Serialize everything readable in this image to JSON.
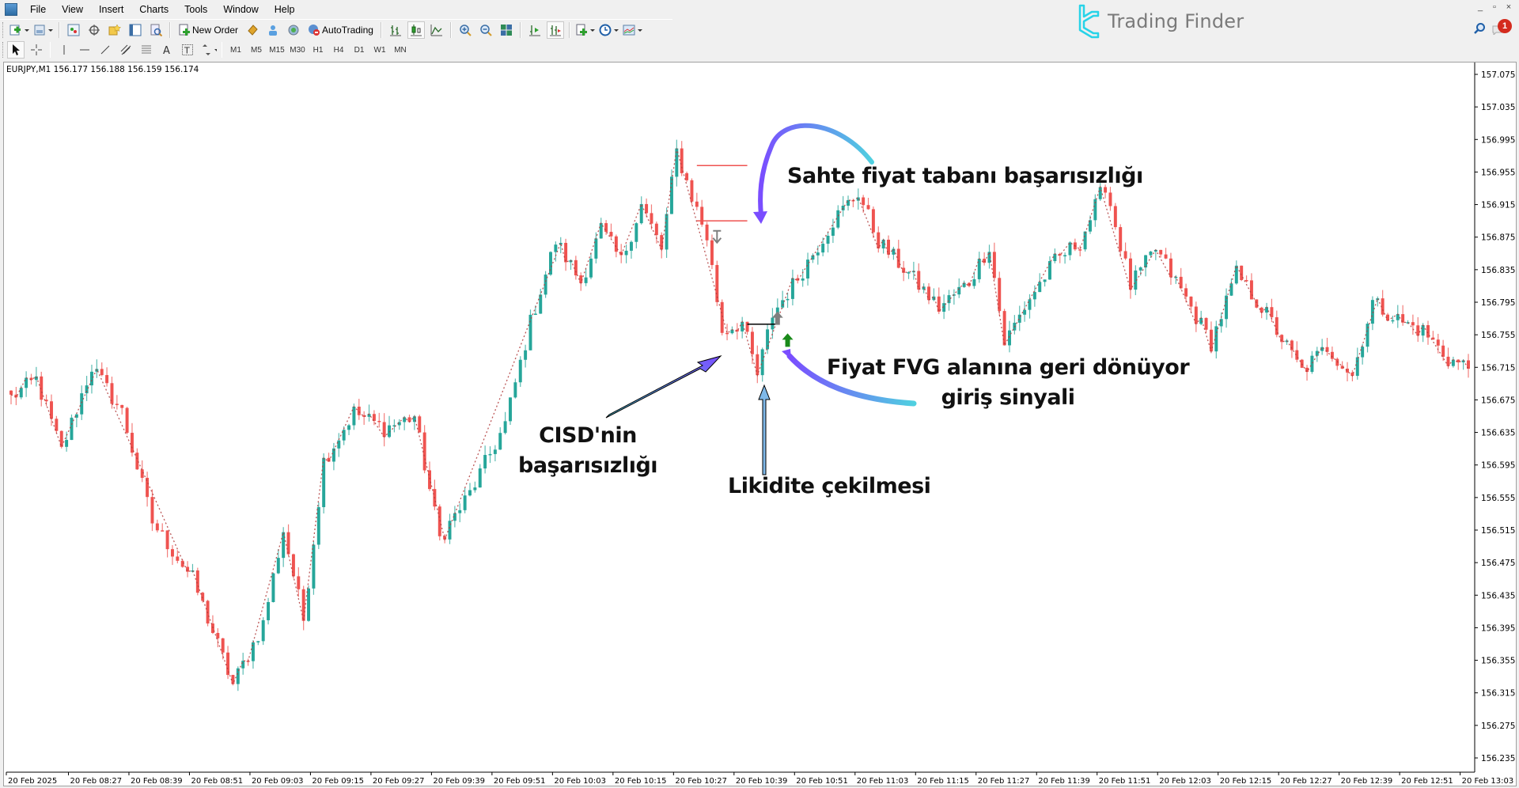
{
  "menu": [
    "File",
    "View",
    "Insert",
    "Charts",
    "Tools",
    "Window",
    "Help"
  ],
  "toolbar": {
    "new_order_label": "New Order",
    "autotrading_label": "AutoTrading",
    "timeframes": [
      "M1",
      "M5",
      "M15",
      "M30",
      "H1",
      "H4",
      "D1",
      "W1",
      "MN"
    ]
  },
  "branding": {
    "logo_text": "Trading Finder",
    "notification_count": "1"
  },
  "window_controls": [
    "_",
    "▫",
    "×"
  ],
  "chart_data": {
    "type": "candlestick",
    "symbol_header": "EURJPY,M1  156.177 156.188 156.159 156.174",
    "symbol": "EURJPY",
    "timeframe": "M1",
    "ohlc_header": [
      156.177,
      156.188,
      156.159,
      156.174
    ],
    "y_range": [
      156.215,
      157.095
    ],
    "y_ticks": [
      157.075,
      157.035,
      156.995,
      156.955,
      156.915,
      156.875,
      156.835,
      156.795,
      156.755,
      156.715,
      156.675,
      156.635,
      156.595,
      156.555,
      156.515,
      156.475,
      156.435,
      156.395,
      156.355,
      156.315,
      156.275,
      156.235
    ],
    "x_ticks": [
      {
        "i": 0,
        "label": "20 Feb 2025"
      },
      {
        "i": 12,
        "label": "20 Feb 08:27"
      },
      {
        "i": 24,
        "label": "20 Feb 08:39"
      },
      {
        "i": 36,
        "label": "20 Feb 08:51"
      },
      {
        "i": 48,
        "label": "20 Feb 09:03"
      },
      {
        "i": 60,
        "label": "20 Feb 09:15"
      },
      {
        "i": 72,
        "label": "20 Feb 09:27"
      },
      {
        "i": 84,
        "label": "20 Feb 09:39"
      },
      {
        "i": 96,
        "label": "20 Feb 09:51"
      },
      {
        "i": 108,
        "label": "20 Feb 10:03"
      },
      {
        "i": 120,
        "label": "20 Feb 10:15"
      },
      {
        "i": 132,
        "label": "20 Feb 10:27"
      },
      {
        "i": 144,
        "label": "20 Feb 10:39"
      },
      {
        "i": 156,
        "label": "20 Feb 10:51"
      },
      {
        "i": 168,
        "label": "20 Feb 11:03"
      },
      {
        "i": 180,
        "label": "20 Feb 11:15"
      },
      {
        "i": 192,
        "label": "20 Feb 11:27"
      },
      {
        "i": 204,
        "label": "20 Feb 11:39"
      },
      {
        "i": 216,
        "label": "20 Feb 11:51"
      },
      {
        "i": 228,
        "label": "20 Feb 12:03"
      },
      {
        "i": 240,
        "label": "20 Feb 12:15"
      },
      {
        "i": 252,
        "label": "20 Feb 12:27"
      },
      {
        "i": 264,
        "label": "20 Feb 12:39"
      },
      {
        "i": 276,
        "label": "20 Feb 12:51"
      },
      {
        "i": 288,
        "label": "20 Feb 13:03"
      }
    ],
    "candle_count": 290,
    "close_waypoints": [
      [
        0,
        156.678
      ],
      [
        5,
        156.7
      ],
      [
        10,
        156.612
      ],
      [
        16,
        156.716
      ],
      [
        22,
        156.66
      ],
      [
        28,
        156.525
      ],
      [
        36,
        156.455
      ],
      [
        44,
        156.325
      ],
      [
        50,
        156.4
      ],
      [
        54,
        156.515
      ],
      [
        58,
        156.405
      ],
      [
        62,
        156.6
      ],
      [
        68,
        156.66
      ],
      [
        74,
        156.64
      ],
      [
        80,
        156.655
      ],
      [
        85,
        156.505
      ],
      [
        91,
        156.56
      ],
      [
        98,
        156.645
      ],
      [
        103,
        156.77
      ],
      [
        108,
        156.87
      ],
      [
        113,
        156.82
      ],
      [
        117,
        156.885
      ],
      [
        121,
        156.845
      ],
      [
        125,
        156.915
      ],
      [
        129,
        156.86
      ],
      [
        132,
        156.98
      ],
      [
        135,
        156.925
      ],
      [
        138,
        156.875
      ],
      [
        141,
        156.76
      ],
      [
        145,
        156.77
      ],
      [
        148,
        156.705
      ],
      [
        151,
        156.78
      ],
      [
        156,
        156.825
      ],
      [
        163,
        156.895
      ],
      [
        168,
        156.93
      ],
      [
        172,
        156.87
      ],
      [
        178,
        156.83
      ],
      [
        184,
        156.788
      ],
      [
        190,
        156.82
      ],
      [
        194,
        156.865
      ],
      [
        197,
        156.745
      ],
      [
        202,
        156.8
      ],
      [
        207,
        156.845
      ],
      [
        212,
        156.87
      ],
      [
        217,
        156.94
      ],
      [
        222,
        156.815
      ],
      [
        227,
        156.86
      ],
      [
        232,
        156.81
      ],
      [
        238,
        156.745
      ],
      [
        243,
        156.83
      ],
      [
        249,
        156.78
      ],
      [
        256,
        156.71
      ],
      [
        261,
        156.74
      ],
      [
        266,
        156.705
      ],
      [
        270,
        156.795
      ],
      [
        276,
        156.77
      ],
      [
        280,
        156.76
      ],
      [
        285,
        156.725
      ],
      [
        289,
        156.715
      ]
    ],
    "candle_colors": {
      "bull": "#26a69a",
      "bear": "#ef5350",
      "zigzag": "#b03a3a"
    },
    "levels": [
      {
        "name": "fvg-top",
        "price": 156.963,
        "color": "#ef5350",
        "from_i": 136,
        "to_i": 146
      },
      {
        "name": "fvg-bottom",
        "price": 156.895,
        "color": "#ef5350",
        "from_i": 136,
        "to_i": 146
      },
      {
        "name": "cisd-line",
        "price": 156.768,
        "color": "#000000",
        "from_i": 146,
        "to_i": 152
      }
    ],
    "signals": [
      {
        "type": "down-arrow",
        "i": 140,
        "price": 156.875,
        "color": "#7f7f7f"
      },
      {
        "type": "up-arrow-gray",
        "i": 152,
        "price": 156.775,
        "color": "#7f7f7f"
      },
      {
        "type": "up-arrow-green",
        "i": 154,
        "price": 156.748,
        "color": "#1a8a1a"
      }
    ]
  },
  "annotations": {
    "fake_floor": "Sahte fiyat tabanı başarısızlığı",
    "cisd_line1": "CISD'nin",
    "cisd_line2": "başarısızlığı",
    "liquidity": "Likidite çekilmesi",
    "fvg_line1": "Fiyat FVG alanına geri dönüyor",
    "fvg_line2": "giriş sinyali"
  }
}
